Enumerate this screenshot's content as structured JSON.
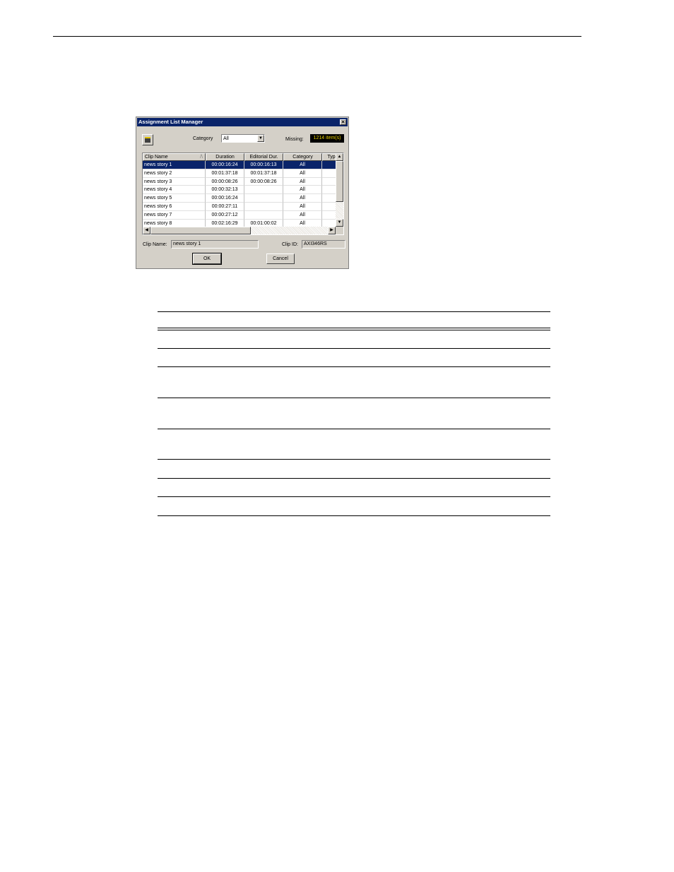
{
  "dialog": {
    "title": "Assignment List Manager",
    "close_glyph": "✕",
    "tool_icon": "clip-database-icon",
    "category_label": "Category",
    "category_value": "All",
    "missing_label": "Missing:",
    "missing_value": "1214 item(s)",
    "columns": [
      "Clip Name",
      "Duration",
      "Editorial Dur.",
      "Category",
      "Typ"
    ],
    "sort_glyph": "/\\",
    "rows": [
      [
        "news story 1",
        "00:00:16:24",
        "00:00:16:13",
        "All",
        ""
      ],
      [
        "news story 2",
        "00:01:37:18",
        "00:01:37:18",
        "All",
        ""
      ],
      [
        "news story 3",
        "00:00:08:26",
        "00:00:08:26",
        "All",
        ""
      ],
      [
        "news story 4",
        "00:00:32:13",
        "",
        "All",
        ""
      ],
      [
        "news story 5",
        "00:00:16:24",
        "",
        "All",
        ""
      ],
      [
        "news story 6",
        "00:00:27:11",
        "",
        "All",
        ""
      ],
      [
        "news story 7",
        "00:00:27:12",
        "",
        "All",
        ""
      ],
      [
        "news story 8",
        "00:02:16:29",
        "00:01:00:02",
        "All",
        ""
      ]
    ],
    "selected_row": 0,
    "clip_name_label": "Clip Name:",
    "clip_name_value": "news story 1",
    "clip_id_label": "Clip ID:",
    "clip_id_value": "AXI346RS",
    "ok_label": "OK",
    "cancel_label": "Cancel",
    "scroll_up": "▲",
    "scroll_down": "▼",
    "scroll_left": "◀",
    "scroll_right": "▶",
    "combo_arrow": "▼"
  }
}
